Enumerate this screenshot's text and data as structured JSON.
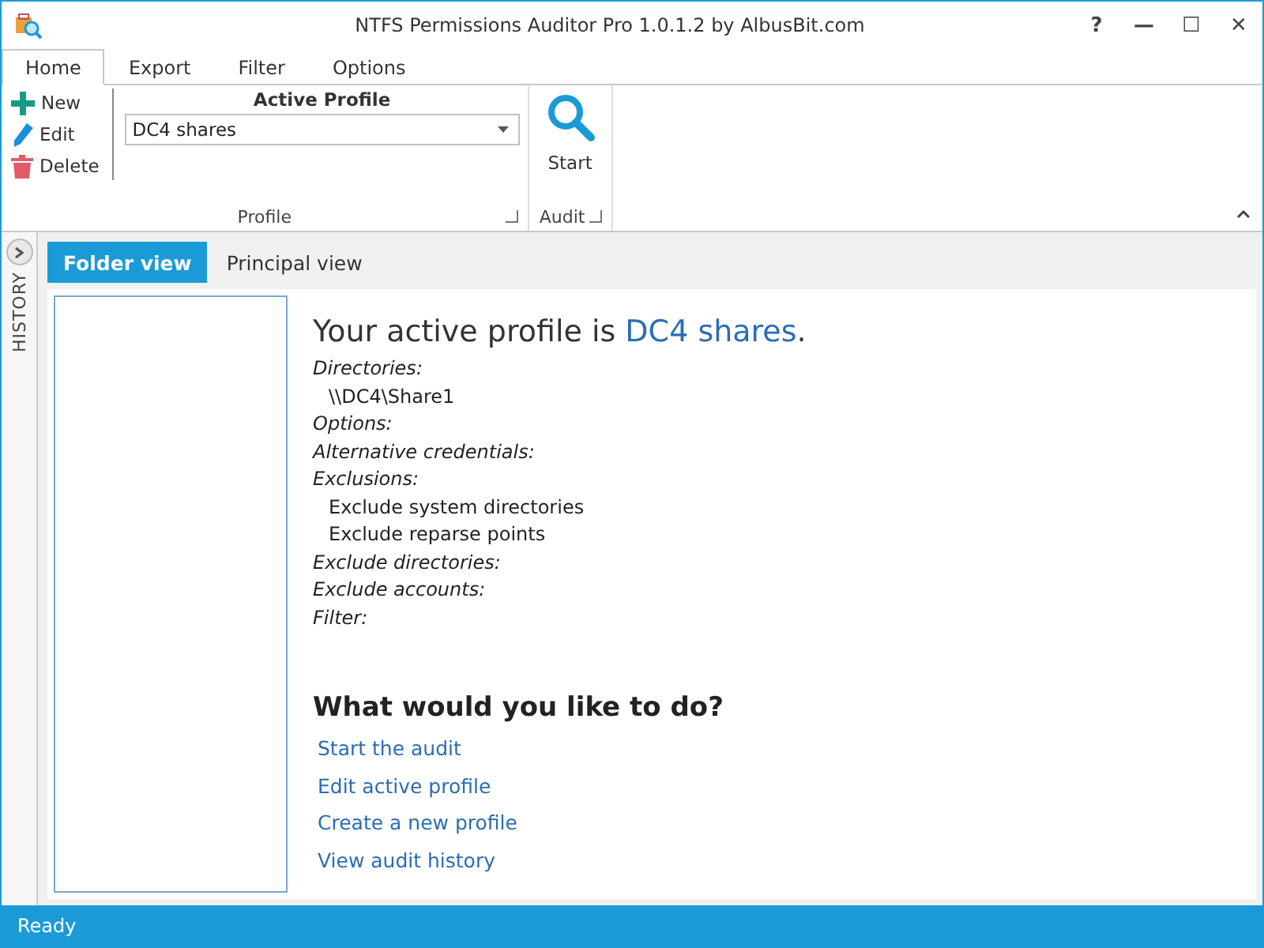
{
  "window": {
    "title": "NTFS Permissions Auditor Pro 1.0.1.2 by AlbusBit.com",
    "controls": [
      "?",
      "—",
      "☐",
      "✕"
    ]
  },
  "ribbon_tabs": [
    {
      "label": "Home",
      "selected": true
    },
    {
      "label": "Export",
      "selected": false
    },
    {
      "label": "Filter",
      "selected": false
    },
    {
      "label": "Options",
      "selected": false
    }
  ],
  "ribbon": {
    "profile_group": {
      "label": "Profile",
      "buttons": [
        {
          "kind": "new",
          "label": "New"
        },
        {
          "kind": "edit",
          "label": "Edit"
        },
        {
          "kind": "delete",
          "label": "Delete"
        }
      ],
      "active_profile": {
        "label": "Active Profile",
        "value": "DC4 shares"
      }
    },
    "audit_group": {
      "label": "Audit",
      "button": "Start"
    }
  },
  "side_panel": {
    "label": "HISTORY",
    "expanded": false
  },
  "view_tabs": [
    {
      "label": "Folder view",
      "selected": true
    },
    {
      "label": "Principal view",
      "selected": false
    }
  ],
  "summary": {
    "heading_prefix": "Your active profile is ",
    "profile": "DC4 shares",
    "heading_suffix": ".",
    "details": [
      {
        "kind": "label",
        "text": "Directories:"
      },
      {
        "kind": "value",
        "text": "\\\\DC4\\Share1"
      },
      {
        "kind": "label",
        "text": "Options:"
      },
      {
        "kind": "label",
        "text": "Alternative credentials:"
      },
      {
        "kind": "label",
        "text": "Exclusions:"
      },
      {
        "kind": "value",
        "text": "Exclude system directories"
      },
      {
        "kind": "value",
        "text": "Exclude reparse points"
      },
      {
        "kind": "label",
        "text": "Exclude directories:"
      },
      {
        "kind": "label",
        "text": "Exclude accounts:"
      },
      {
        "kind": "label",
        "text": "Filter:"
      }
    ],
    "actions_title": "What would you like to do?",
    "actions": [
      "Start the audit",
      "Edit active profile",
      "Create a new profile",
      "View audit history"
    ]
  },
  "status_bar": "Ready"
}
